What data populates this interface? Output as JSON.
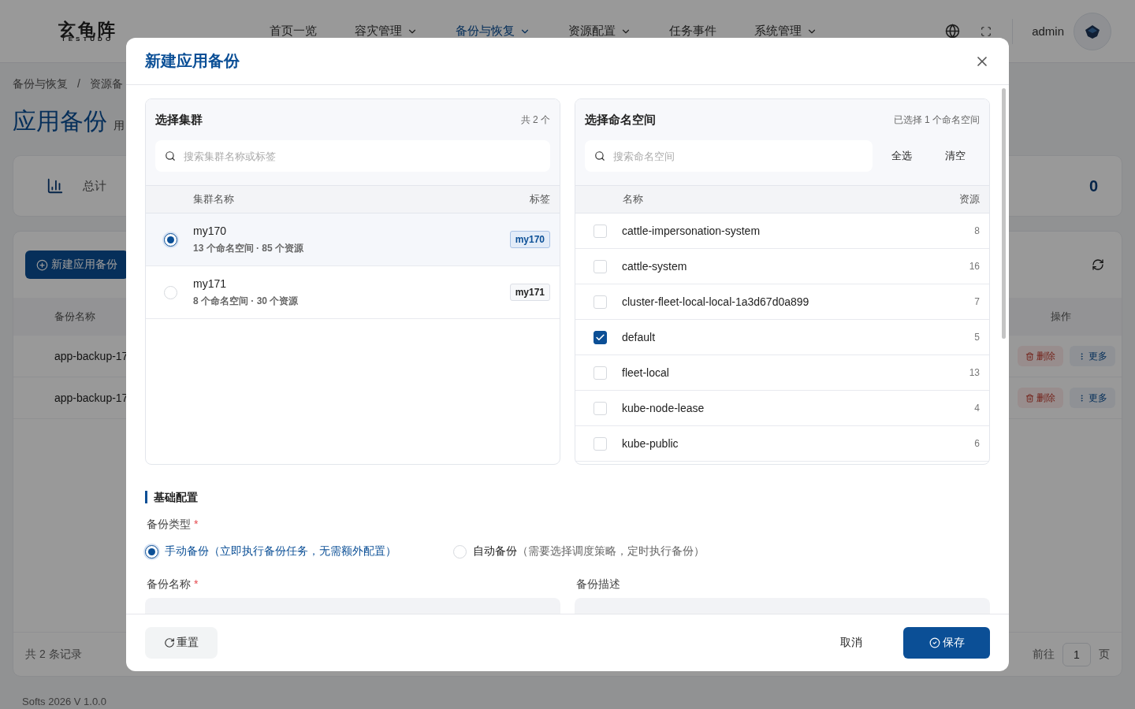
{
  "header": {
    "logo": "玄龟阵",
    "logo_sub": "TESTUDO",
    "user": "admin",
    "nav": [
      {
        "label": "首页一览",
        "selected": false,
        "dropdown": false
      },
      {
        "label": "容灾管理",
        "selected": false,
        "dropdown": true
      },
      {
        "label": "备份与恢复",
        "selected": true,
        "dropdown": true
      },
      {
        "label": "资源配置",
        "selected": false,
        "dropdown": true
      },
      {
        "label": "任务事件",
        "selected": false,
        "dropdown": false
      },
      {
        "label": "系统管理",
        "selected": false,
        "dropdown": true
      }
    ]
  },
  "breadcrumb": {
    "separator": "/",
    "items": [
      "备份与恢复",
      "资源备"
    ]
  },
  "page": {
    "title": "应用备份",
    "subtitle": "用"
  },
  "stats": {
    "label": "总计",
    "value": "0"
  },
  "list": {
    "create_button": "新建应用备份",
    "columns": [
      "备份名称",
      "操作"
    ],
    "rows": [
      {
        "name": "app-backup-17",
        "actions": [
          "删除",
          "更多"
        ]
      },
      {
        "name": "app-backup-17",
        "actions": [
          "删除",
          "更多"
        ]
      }
    ],
    "total": "共 2 条记录",
    "goto_label": "前往",
    "page": "1",
    "page_suffix": "页"
  },
  "footer": "Softs 2026 V 1.0.0",
  "modal": {
    "title": "新建应用备份",
    "clusters": {
      "title": "选择集群",
      "count": "共 2 个",
      "search_placeholder": "搜索集群名称或标签",
      "columns": [
        "集群名称",
        "标签"
      ],
      "items": [
        {
          "name": "my170",
          "meta": "13 个命名空间 · 85 个资源",
          "tag": "my170",
          "selected": true
        },
        {
          "name": "my171",
          "meta": "8 个命名空间 · 30 个资源",
          "tag": "my171",
          "selected": false
        }
      ]
    },
    "namespaces": {
      "title": "选择命名空间",
      "summary": "已选择 1 个命名空间",
      "search_placeholder": "搜索命名空间",
      "select_all": "全选",
      "clear": "清空",
      "columns": [
        "名称",
        "资源"
      ],
      "items": [
        {
          "name": "cattle-impersonation-system",
          "count": "8",
          "checked": false
        },
        {
          "name": "cattle-system",
          "count": "16",
          "checked": false
        },
        {
          "name": "cluster-fleet-local-local-1a3d67d0a899",
          "count": "7",
          "checked": false
        },
        {
          "name": "default",
          "count": "5",
          "checked": true
        },
        {
          "name": "fleet-local",
          "count": "13",
          "checked": false
        },
        {
          "name": "kube-node-lease",
          "count": "4",
          "checked": false
        },
        {
          "name": "kube-public",
          "count": "6",
          "checked": false
        }
      ]
    },
    "section": "基础配置",
    "backup_type": {
      "label": "备份类型",
      "required_mark": "*",
      "options": [
        {
          "label": "手动备份",
          "hint": "（立即执行备份任务，无需额外配置）",
          "selected": true
        },
        {
          "label": "自动备份",
          "hint": "（需要选择调度策略，定时执行备份）",
          "selected": false
        }
      ]
    },
    "fields": [
      {
        "label": "备份名称",
        "required_mark": "*"
      },
      {
        "label": "备份描述"
      }
    ],
    "reset": "重置",
    "cancel": "取消",
    "save": "保存"
  }
}
